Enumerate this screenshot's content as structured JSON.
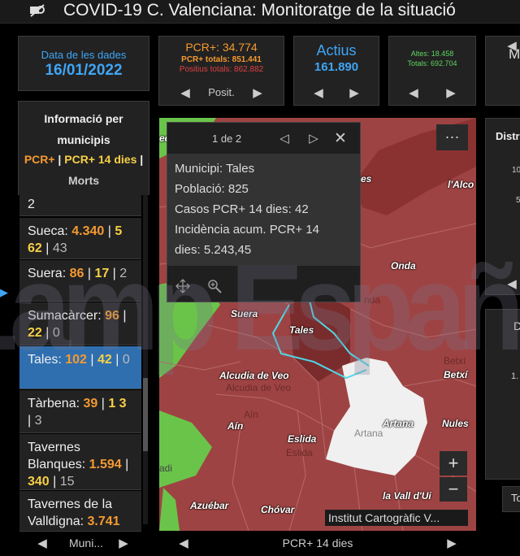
{
  "header": {
    "title": "COVID-19 C. Valenciana: Monitoratge de la situació"
  },
  "date_card": {
    "label": "Data de les dades",
    "value": "16/01/2022"
  },
  "pcr_card": {
    "pcr": "PCR+: 34.774",
    "pcr_totals": "PCR+ totals: 851.441",
    "positius_totals": "Positius totals: 862.882",
    "nav_label": "Posit."
  },
  "actius_card": {
    "label": "Actius",
    "value": "161.890"
  },
  "altes_card": {
    "altes": "Altes: 18.458",
    "totals": "Totals: 692.704"
  },
  "partial_card": {
    "label": "M"
  },
  "distr_card": {
    "label": "Distr",
    "tick1": "10",
    "tick2": "5"
  },
  "right_card2": {
    "label": "D",
    "tick": "1."
  },
  "right_tab": {
    "label": "To"
  },
  "municipis_panel": {
    "title_line1": "Informació per",
    "title_line2": "municipis",
    "legend_pcr": "PCR+",
    "legend_sep1": " | ",
    "legend_pcr14": "PCR+ 14 dies",
    "legend_sep2": " |",
    "legend_morts": "Morts",
    "nav_label": "Muni...",
    "partial_value": "2",
    "items": [
      {
        "name": "Sueca: ",
        "pcr": "4.340",
        "sep1": "  |  ",
        "pcr14": "5 62",
        "sep2": " | ",
        "morts": "43"
      },
      {
        "name": "Suera: ",
        "pcr": "86",
        "sep1": "  |  ",
        "pcr14": "17",
        "sep2": "  |  ",
        "morts": "2"
      },
      {
        "name": "Sumacàrcer: ",
        "pcr": "96",
        "sep1": "  |  ",
        "pcr14": "22",
        "sep2": " | ",
        "morts": "0"
      },
      {
        "name": "Tales: ",
        "pcr": "102",
        "sep1": "  |  ",
        "pcr14": "42",
        "sep2": "  |  ",
        "morts": "0"
      },
      {
        "name": "Tàrbena: ",
        "pcr": "39",
        "sep1": "  |  ",
        "pcr14": "1 3",
        "sep2": " | ",
        "morts": "3"
      },
      {
        "name": "Tavernes Blanques: ",
        "pcr": "1.594",
        "sep1": "  |  ",
        "pcr14": "340",
        "sep2": "  |  ",
        "morts": "15"
      },
      {
        "name": "Tavernes de la Valldigna: ",
        "pcr": "3.741",
        "sep1": "",
        "pcr14": "",
        "sep2": "",
        "morts": ""
      }
    ]
  },
  "popup": {
    "counter": "1 de 2",
    "municipi": "Municipi: Tales",
    "poblacio": "Població: 825",
    "casos": "Casos PCR+ 14 dies: 42",
    "incidencia_1": "Incidència acum. PCR+ 14",
    "incidencia_2": "dies: 5.243,45"
  },
  "map": {
    "menu": "···",
    "attribution": "Institut Cartogràfic V...",
    "nav_label": "PCR+ 14 dies",
    "places": {
      "alcora": "l'Alco",
      "onda": "Onda",
      "suera": "Suera",
      "tales": "Tales",
      "alcudia": "Alcudia de Veo",
      "betxi": "Betxí",
      "ain": "Aín",
      "eslida": "Eslida",
      "artana": "Artana",
      "nules": "Nules",
      "azuebar": "Azuébar",
      "chovar": "Chóvar",
      "vall_uixo": "la Vall d'Ui",
      "es": "es",
      "ed": "ed"
    },
    "faint": {
      "onda": "nda",
      "alcudia": "Alcudia de Veo",
      "betxi": "Betxí",
      "ain": "Aín",
      "eslida": "Eslida",
      "artana": "Artana",
      "adi": "adi"
    },
    "zoom_in": "+",
    "zoom_out": "−"
  },
  "watermark": {
    "text": "Lamp Español"
  },
  "colors": {
    "accent": "#3fa5f5",
    "pcr": "#f59a30",
    "pcr14": "#f7d046",
    "red": "#e04040",
    "green": "#5fd65f",
    "map_red": "#9e4343"
  }
}
